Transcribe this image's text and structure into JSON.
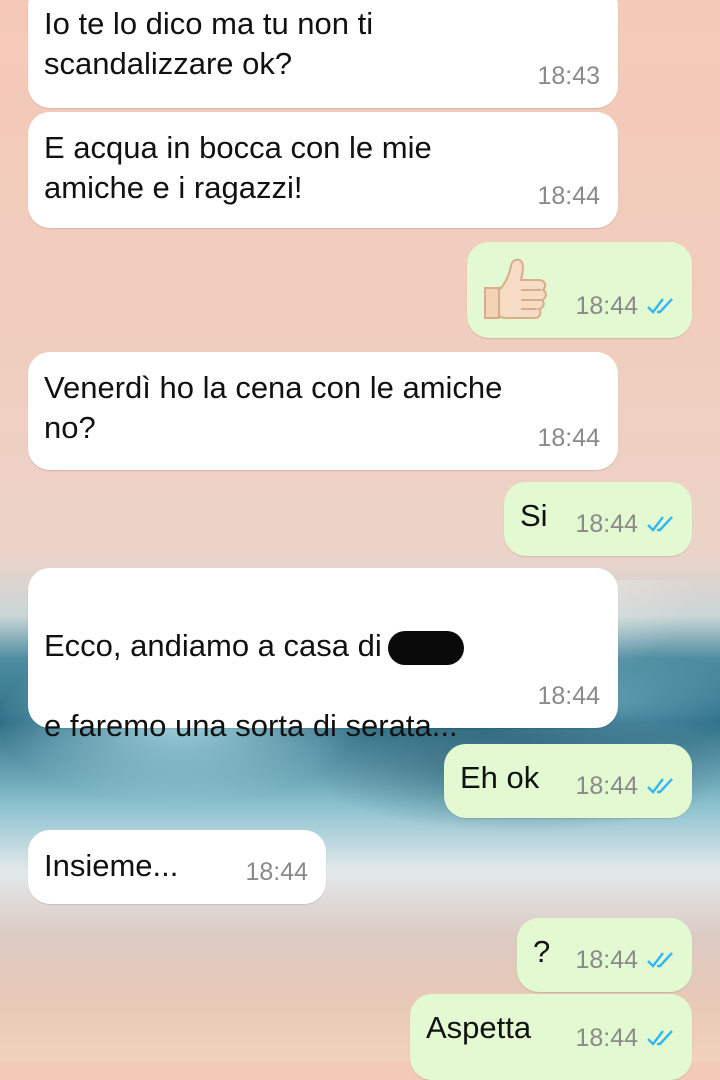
{
  "messages": [
    {
      "text": "Io te lo dico ma tu non ti\nscandalizzare ok?",
      "time": "18:43",
      "dir": "in"
    },
    {
      "text": "E acqua in bocca con le mie\namiche e i ragazzi!",
      "time": "18:44",
      "dir": "in"
    },
    {
      "emoji": "thumbs-up-icon",
      "time": "18:44",
      "dir": "out"
    },
    {
      "text": "Venerdì ho la cena con le amiche\nno?",
      "time": "18:44",
      "dir": "in"
    },
    {
      "text": "Si",
      "time": "18:44",
      "dir": "out"
    },
    {
      "text_a": "Ecco, andiamo a casa di",
      "text_b": "e faremo una sorta di serata...",
      "time": "18:44",
      "dir": "in"
    },
    {
      "text": "Eh ok",
      "time": "18:44",
      "dir": "out"
    },
    {
      "text": "Insieme...",
      "time": "18:44",
      "dir": "in"
    },
    {
      "text": "?",
      "time": "18:44",
      "dir": "out"
    },
    {
      "text": "Aspetta",
      "time": "18:44",
      "dir": "out"
    }
  ],
  "colors": {
    "incoming": "#ffffff",
    "outgoing": "#e3f9d2",
    "read_ticks": "#34b7f1"
  }
}
